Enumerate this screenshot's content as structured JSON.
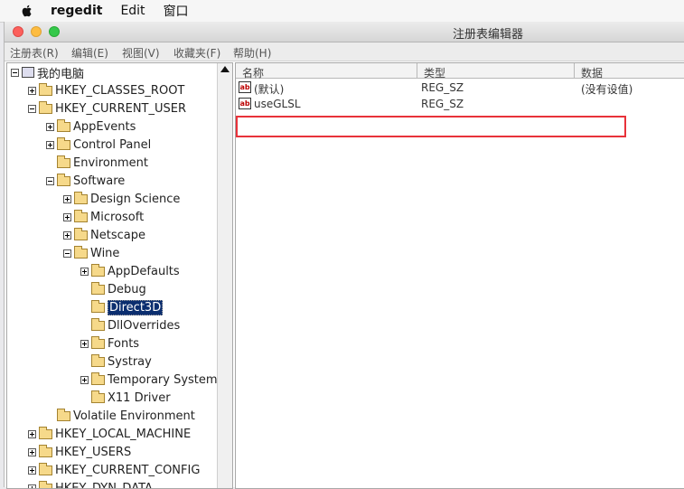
{
  "menubar": {
    "app_name": "regedit",
    "items": [
      "Edit",
      "窗口"
    ]
  },
  "window": {
    "title": "注册表编辑器"
  },
  "app_menu": [
    "注册表(R)",
    "编辑(E)",
    "视图(V)",
    "收藏夹(F)",
    "帮助(H)"
  ],
  "tree": {
    "root": "我的电脑",
    "nodes": [
      {
        "label": "HKEY_CLASSES_ROOT"
      },
      {
        "label": "HKEY_CURRENT_USER"
      },
      {
        "label": "AppEvents"
      },
      {
        "label": "Control Panel"
      },
      {
        "label": "Environment"
      },
      {
        "label": "Software"
      },
      {
        "label": "Design Science"
      },
      {
        "label": "Microsoft"
      },
      {
        "label": "Netscape"
      },
      {
        "label": "Wine"
      },
      {
        "label": "AppDefaults"
      },
      {
        "label": "Debug"
      },
      {
        "label": "Direct3D"
      },
      {
        "label": "DllOverrides"
      },
      {
        "label": "Fonts"
      },
      {
        "label": "Systray"
      },
      {
        "label": "Temporary System"
      },
      {
        "label": "X11 Driver"
      },
      {
        "label": "Volatile Environment"
      },
      {
        "label": "HKEY_LOCAL_MACHINE"
      },
      {
        "label": "HKEY_USERS"
      },
      {
        "label": "HKEY_CURRENT_CONFIG"
      },
      {
        "label": "HKEY_DYN_DATA"
      }
    ]
  },
  "list": {
    "columns": [
      "名称",
      "类型",
      "数据"
    ],
    "rows": [
      {
        "name": "(默认)",
        "type": "REG_SZ",
        "data": "(没有设值)"
      },
      {
        "name": "useGLSL",
        "type": "REG_SZ",
        "data": ""
      }
    ]
  },
  "icons": {
    "string_value": "ab"
  }
}
